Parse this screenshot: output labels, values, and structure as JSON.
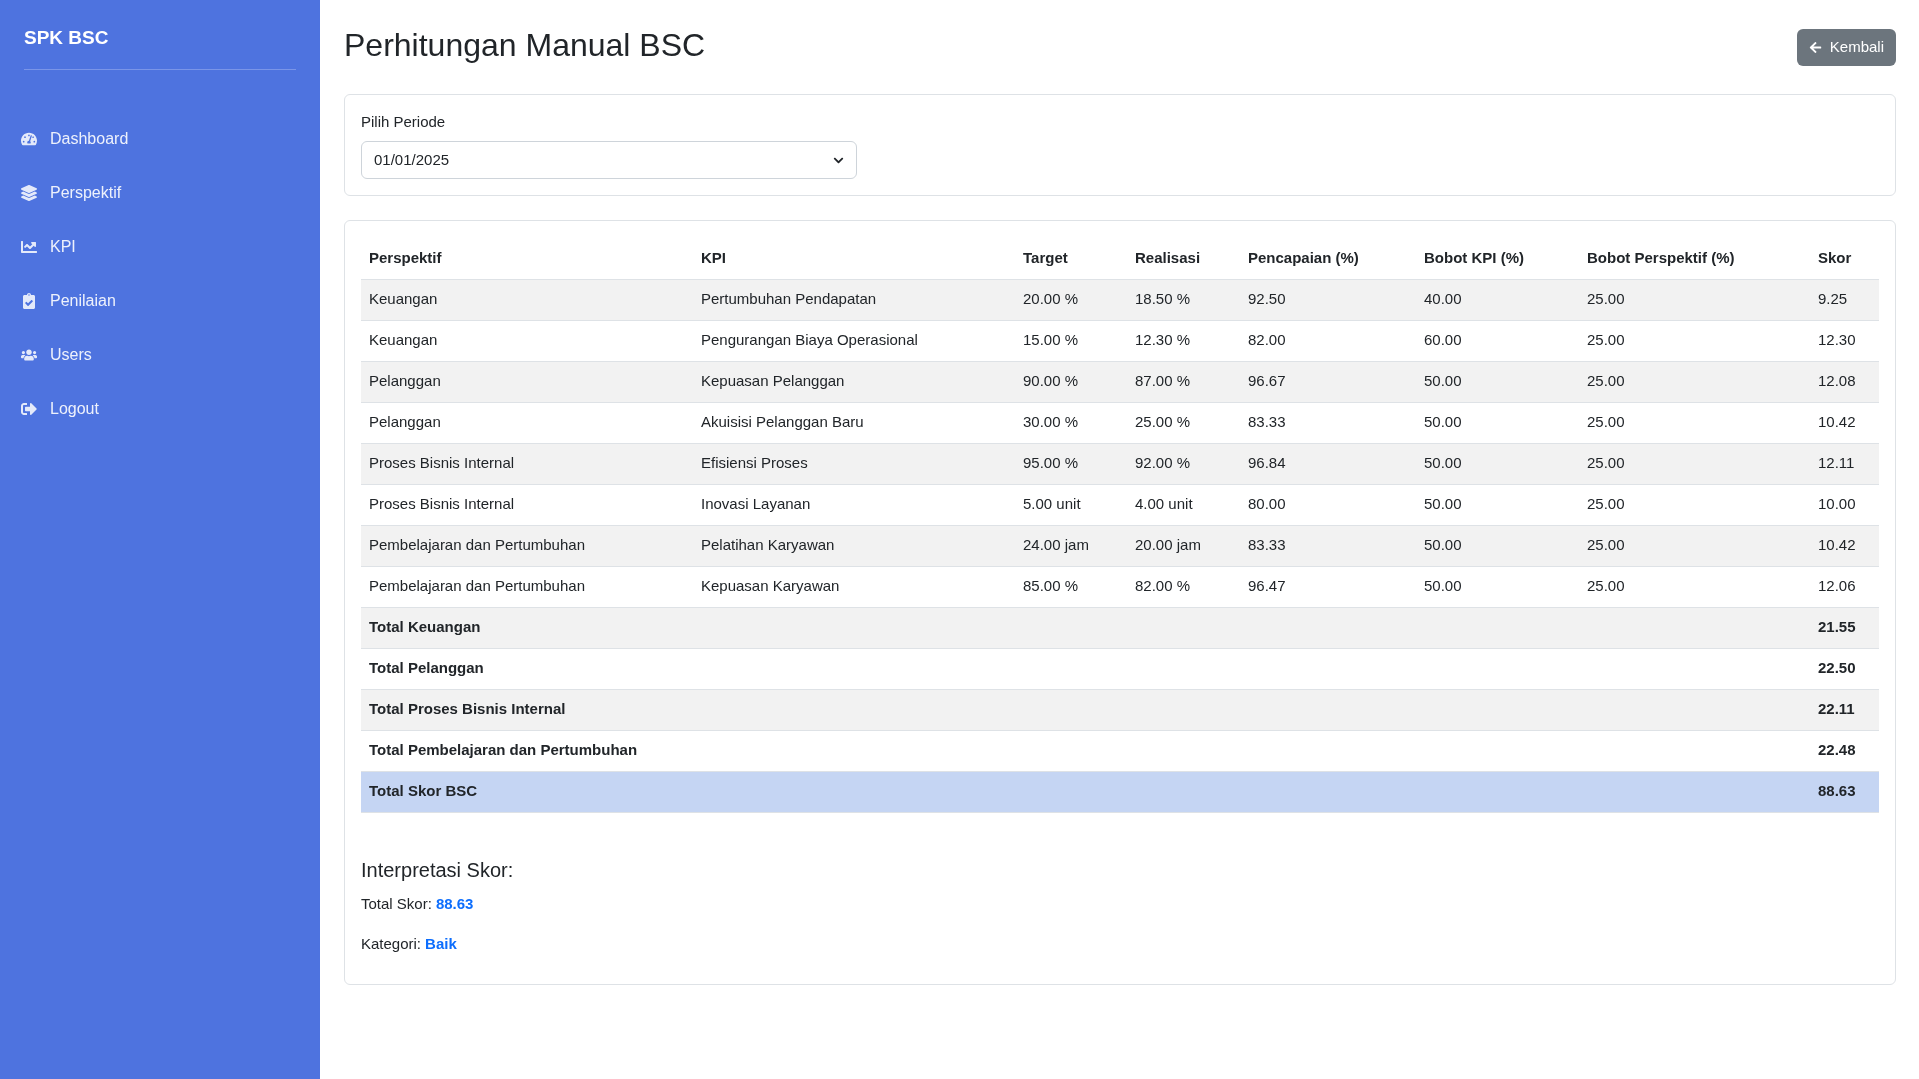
{
  "sidebar": {
    "brand": "SPK BSC",
    "items": [
      {
        "label": "Dashboard"
      },
      {
        "label": "Perspektif"
      },
      {
        "label": "KPI"
      },
      {
        "label": "Penilaian"
      },
      {
        "label": "Users"
      },
      {
        "label": "Logout"
      }
    ]
  },
  "header": {
    "title": "Perhitungan Manual BSC",
    "back_button": "Kembali"
  },
  "period": {
    "label": "Pilih Periode",
    "value": "01/01/2025"
  },
  "table": {
    "columns": [
      "Perspektif",
      "KPI",
      "Target",
      "Realisasi",
      "Pencapaian (%)",
      "Bobot KPI (%)",
      "Bobot Perspektif (%)",
      "Skor"
    ],
    "rows": [
      {
        "kind": "item",
        "cells": [
          "Keuangan",
          "Pertumbuhan Pendapatan",
          "20.00 %",
          "18.50 %",
          "92.50",
          "40.00",
          "25.00",
          "9.25"
        ]
      },
      {
        "kind": "item",
        "cells": [
          "Keuangan",
          "Pengurangan Biaya Operasional",
          "15.00 %",
          "12.30 %",
          "82.00",
          "60.00",
          "25.00",
          "12.30"
        ]
      },
      {
        "kind": "item",
        "cells": [
          "Pelanggan",
          "Kepuasan Pelanggan",
          "90.00 %",
          "87.00 %",
          "96.67",
          "50.00",
          "25.00",
          "12.08"
        ]
      },
      {
        "kind": "item",
        "cells": [
          "Pelanggan",
          "Akuisisi Pelanggan Baru",
          "30.00 %",
          "25.00 %",
          "83.33",
          "50.00",
          "25.00",
          "10.42"
        ]
      },
      {
        "kind": "item",
        "cells": [
          "Proses Bisnis Internal",
          "Efisiensi Proses",
          "95.00 %",
          "92.00 %",
          "96.84",
          "50.00",
          "25.00",
          "12.11"
        ]
      },
      {
        "kind": "item",
        "cells": [
          "Proses Bisnis Internal",
          "Inovasi Layanan",
          "5.00 unit",
          "4.00 unit",
          "80.00",
          "50.00",
          "25.00",
          "10.00"
        ]
      },
      {
        "kind": "item",
        "cells": [
          "Pembelajaran dan Pertumbuhan",
          "Pelatihan Karyawan",
          "24.00 jam",
          "20.00 jam",
          "83.33",
          "50.00",
          "25.00",
          "10.42"
        ]
      },
      {
        "kind": "item",
        "cells": [
          "Pembelajaran dan Pertumbuhan",
          "Kepuasan Karyawan",
          "85.00 %",
          "82.00 %",
          "96.47",
          "50.00",
          "25.00",
          "12.06"
        ]
      },
      {
        "kind": "total",
        "label": "Total Keuangan",
        "value": "21.55"
      },
      {
        "kind": "total",
        "label": "Total Pelanggan",
        "value": "22.50"
      },
      {
        "kind": "total",
        "label": "Total Proses Bisnis Internal",
        "value": "22.11"
      },
      {
        "kind": "total",
        "label": "Total Pembelajaran dan Pertumbuhan",
        "value": "22.48"
      },
      {
        "kind": "grand",
        "label": "Total Skor BSC",
        "value": "88.63"
      }
    ]
  },
  "interpretation": {
    "title": "Interpretasi Skor:",
    "lines": [
      {
        "label": "Total Skor:",
        "value": "88.63"
      },
      {
        "label": "Kategori:",
        "value": "Baik"
      }
    ]
  }
}
